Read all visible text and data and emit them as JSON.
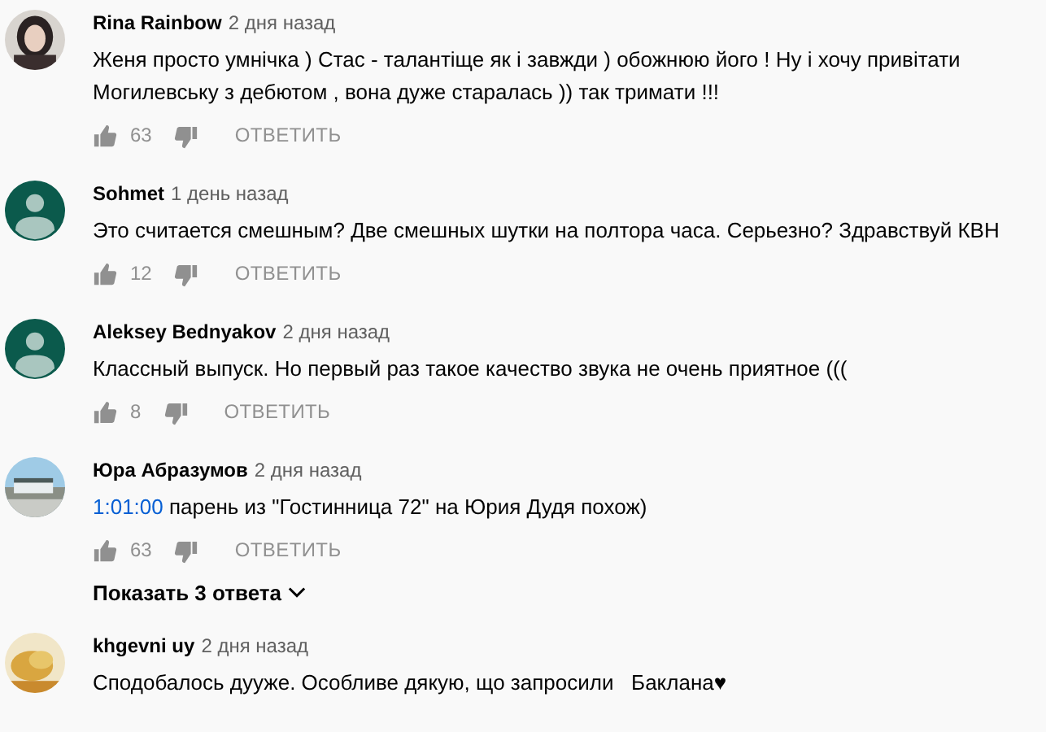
{
  "comments": [
    {
      "author": "Rina Rainbow",
      "time": "2 дня назад",
      "avatar": {
        "kind": "picture"
      },
      "text": [
        {
          "kind": "text",
          "text": "Женя просто умнічка ) Стас - талантіще як і завжди ) обожнюю його ! Ну і хочу привітати Могилевську з дебютом , вона дуже старалась )) так тримати !!!"
        }
      ],
      "likes": "63",
      "reply_label": "ОТВЕТИТЬ"
    },
    {
      "author": "Sohmet",
      "time": "1 день назад",
      "avatar": {
        "kind": "default",
        "color": "#0b5a4c"
      },
      "text": [
        {
          "kind": "text",
          "text": "Это считается смешным? Две смешных шутки на полтора часа. Серьезно? Здравствуй КВН"
        }
      ],
      "likes": "12",
      "reply_label": "ОТВЕТИТЬ"
    },
    {
      "author": "Aleksey Bednyakov",
      "time": "2 дня назад",
      "avatar": {
        "kind": "default",
        "color": "#0b5a4c"
      },
      "text": [
        {
          "kind": "text",
          "text": "Классный выпуск. Но первый раз такое качество звука не очень приятное ((("
        }
      ],
      "likes": "8",
      "reply_label": "ОТВЕТИТЬ"
    },
    {
      "author": "Юра Абразумов",
      "time": "2 дня назад",
      "avatar": {
        "kind": "picture"
      },
      "text": [
        {
          "kind": "timestamp",
          "text": "1:01:00"
        },
        {
          "kind": "text",
          "text": " парень из \"Гостинница 72\" на Юрия Дудя похож)"
        }
      ],
      "likes": "63",
      "reply_label": "ОТВЕТИТЬ",
      "replies_link": "Показать 3 ответа"
    },
    {
      "author": "khgevni uy",
      "time": "2 дня назад",
      "avatar": {
        "kind": "picture"
      },
      "text": [
        {
          "kind": "text",
          "text": "Сподобалось дууже. Особливе дякую, що запросили   Баклана♥"
        }
      ]
    }
  ]
}
